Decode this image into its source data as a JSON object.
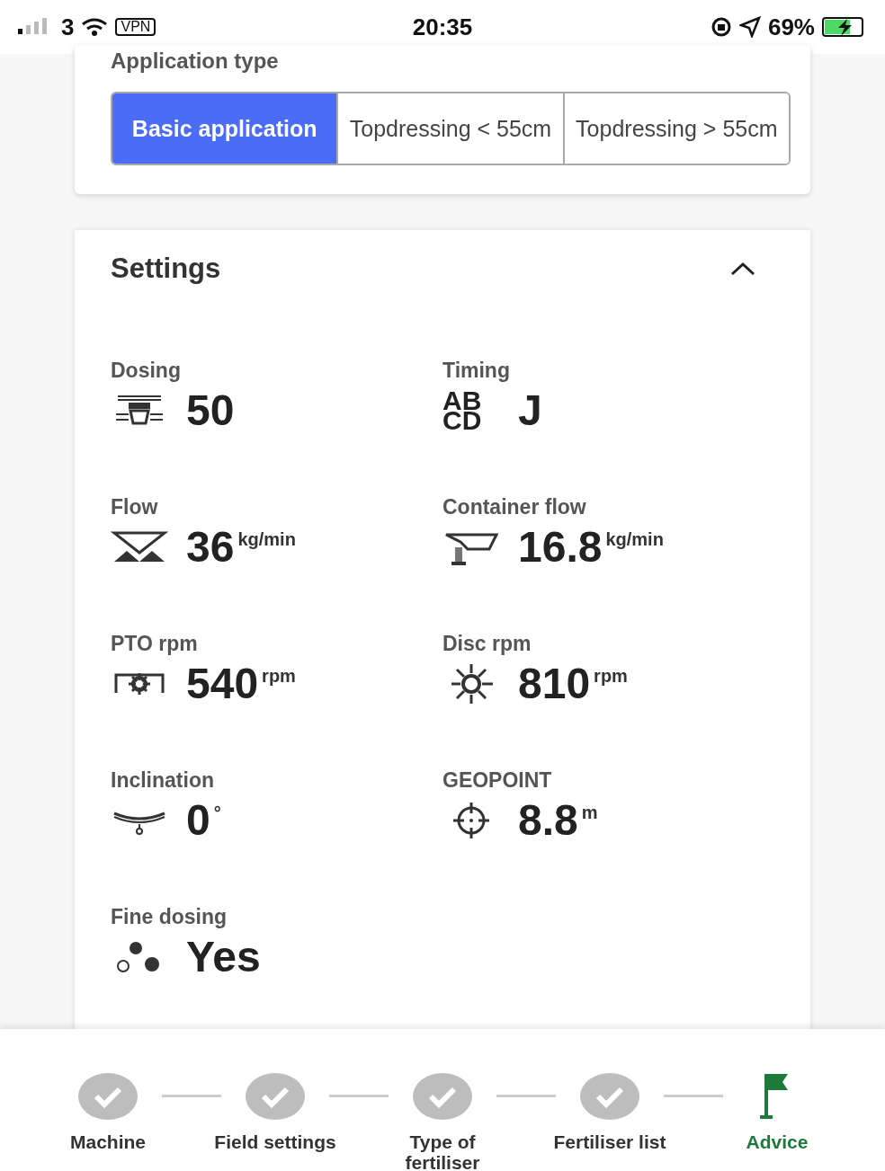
{
  "status_bar": {
    "carrier": "3",
    "vpn": "VPN",
    "time": "20:35",
    "battery": "69%"
  },
  "application_type": {
    "title": "Application type",
    "options": [
      {
        "label": "Basic application",
        "selected": true
      },
      {
        "label": "Topdressing < 55cm",
        "selected": false
      },
      {
        "label": "Topdressing > 55cm",
        "selected": false
      }
    ]
  },
  "settings": {
    "title": "Settings",
    "expanded": true,
    "items": [
      {
        "label": "Dosing",
        "value": "50"
      },
      {
        "label": "Timing",
        "symbol": [
          "AB",
          "CD"
        ],
        "value": "J"
      },
      {
        "label": "Flow",
        "value": "36",
        "unit": "kg/min"
      },
      {
        "label": "Container flow",
        "value": "16.8",
        "unit": "kg/min"
      },
      {
        "label": "PTO rpm",
        "value": "540",
        "unit": "rpm"
      },
      {
        "label": "Disc rpm",
        "value": "810",
        "unit": "rpm"
      },
      {
        "label": "Inclination",
        "value": "0",
        "unit": "°"
      },
      {
        "label": "GEOPOINT",
        "value": "8.8",
        "unit": "m"
      },
      {
        "label": "Fine dosing",
        "value": "Yes"
      }
    ]
  },
  "steps": [
    {
      "label": "Machine",
      "kind": "done"
    },
    {
      "label": "Field settings",
      "kind": "done"
    },
    {
      "label": "Type of fertiliser",
      "kind": "done"
    },
    {
      "label": "Fertiliser list",
      "kind": "done"
    },
    {
      "label": "Advice",
      "kind": "current"
    }
  ]
}
